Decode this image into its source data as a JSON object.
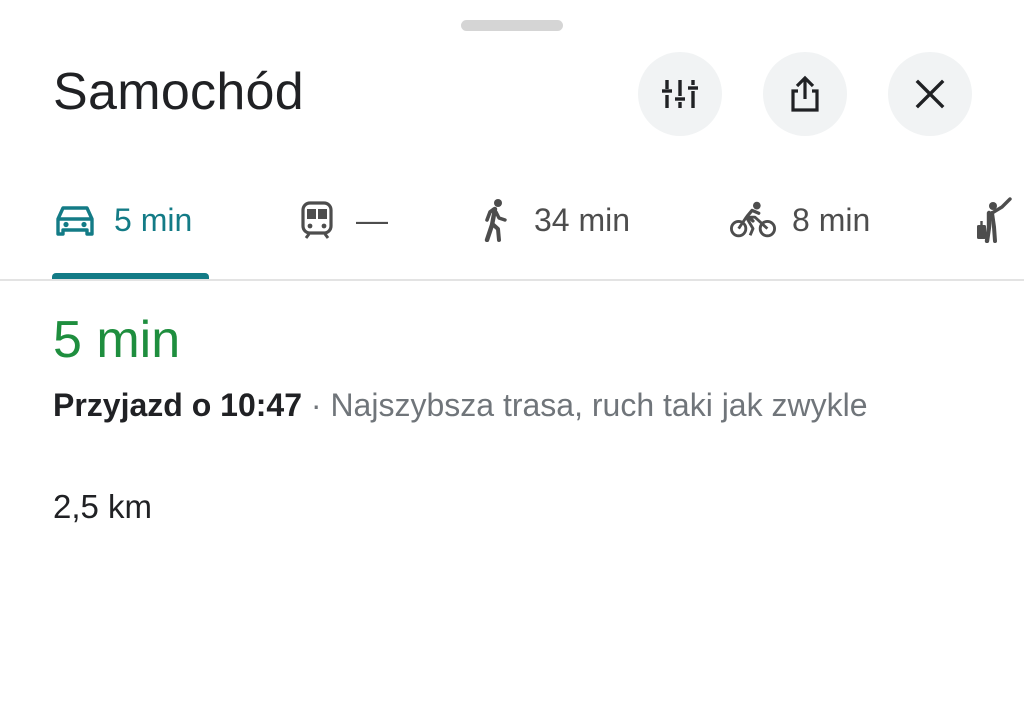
{
  "header": {
    "title": "Samochód"
  },
  "actions": {
    "options_icon": "tune-icon",
    "share_icon": "share-icon",
    "close_icon": "close-icon"
  },
  "modes": [
    {
      "icon": "car-icon",
      "label": "5 min",
      "active": true
    },
    {
      "icon": "train-icon",
      "label": "—",
      "active": false
    },
    {
      "icon": "walk-icon",
      "label": "34 min",
      "active": false
    },
    {
      "icon": "bike-icon",
      "label": "8 min",
      "active": false
    },
    {
      "icon": "ride-hail-icon",
      "label": "",
      "active": false
    }
  ],
  "route": {
    "duration": "5 min",
    "arrival": "Przyjazd o 10:47",
    "separator": " · ",
    "description": "Najszybsza trasa, ruch taki jak zwykle",
    "distance": "2,5 km"
  },
  "colors": {
    "accent": "#137b86",
    "duration_green": "#1e8e3e",
    "button_bg": "#f1f3f4"
  }
}
